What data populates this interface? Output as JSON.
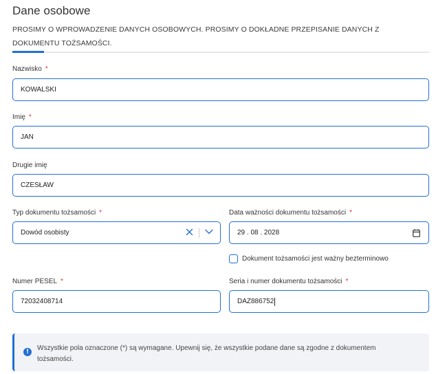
{
  "section": {
    "title": "Dane osobowe",
    "subtitle": "PROSIMY O WPROWADZENIE DANYCH OSOBOWYCH. PROSIMY O DOKŁADNE PRZEPISANIE DANYCH Z DOKUMENTU TOŻSAMOŚCI."
  },
  "form": {
    "required_marker": "*",
    "surname": {
      "label": "Nazwisko",
      "value": "KOWALSKI"
    },
    "first_name": {
      "label": "Imię",
      "value": "JAN"
    },
    "second_name": {
      "label": "Drugie imię",
      "value": "CZESŁAW"
    },
    "document_type": {
      "label": "Typ dokumentu tożsamości",
      "value": "Dowód osobisty"
    },
    "expiry_date": {
      "label": "Data ważności dokumentu tożsamości",
      "value": "29 . 08 . 2028"
    },
    "indefinite_checkbox": {
      "label": "Dokument tożsamości jest ważny bezterminowo",
      "checked": false
    },
    "pesel": {
      "label": "Numer PESEL",
      "value": "72032408714"
    },
    "document_number": {
      "label": "Seria i numer dokumentu tożsamości",
      "value": "DAZ886752"
    }
  },
  "info": {
    "icon": "info-icon",
    "text": "Wszystkie pola oznaczone (*) są wymagane. Upewnij się, że wszystkie podane dane są zgodne z dokumentem tożsamości."
  },
  "colors": {
    "accent": "#1f6fd6",
    "required": "#e0323a",
    "info_background": "#f1f3f6"
  }
}
